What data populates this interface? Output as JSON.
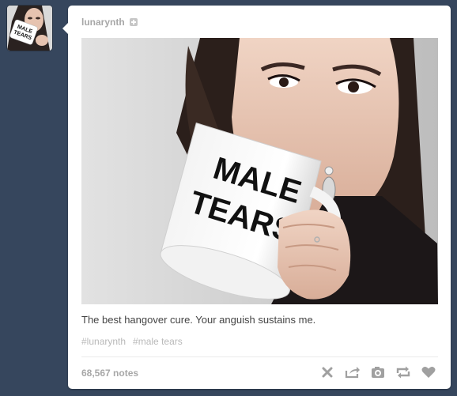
{
  "post": {
    "username": "lunarynth",
    "photo": {
      "mug_text_line1": "MALE",
      "mug_text_line2": "TEARS"
    },
    "caption": "The best hangover cure. Your anguish sustains me.",
    "tags": [
      "#lunarynth",
      "#male tears"
    ],
    "notes": "68,567 notes"
  },
  "controls": {
    "delete_icon": "x-icon",
    "share_icon": "share-icon",
    "edit_icon": "camera-icon",
    "reblog_icon": "reblog-icon",
    "like_icon": "heart-icon"
  },
  "colors": {
    "background": "#36465d",
    "card": "#ffffff",
    "muted_text": "#a7a7a7",
    "icon": "#a0a0a0"
  }
}
